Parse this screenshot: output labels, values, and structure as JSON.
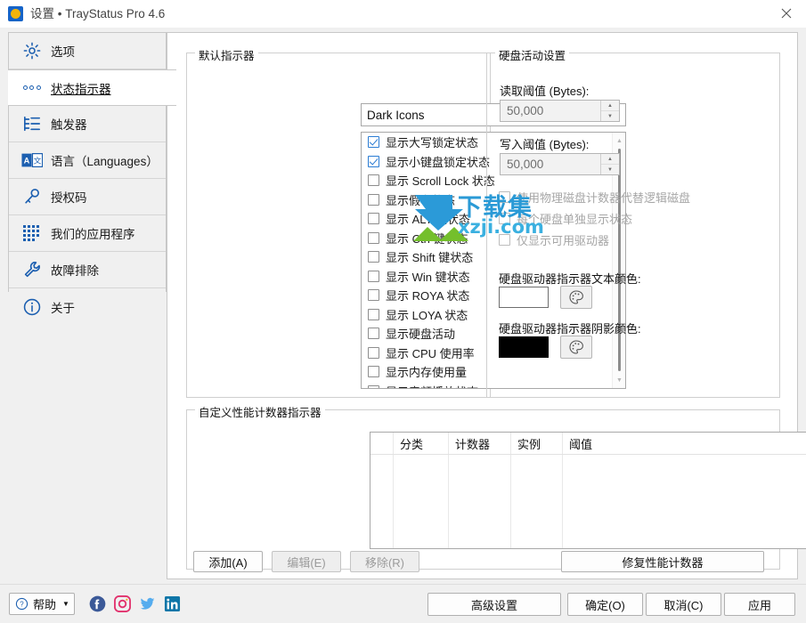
{
  "window": {
    "title": "设置 • TrayStatus Pro 4.6",
    "close_label": "✕",
    "icon": "app-icon"
  },
  "sidebar": {
    "items": [
      {
        "label": "选项",
        "icon": "gear-icon",
        "selected": false
      },
      {
        "label": "状态指示器",
        "icon": "dots-icon",
        "selected": true
      },
      {
        "label": "触发器",
        "icon": "trigger-tree-icon",
        "selected": false
      },
      {
        "label": "语言（Languages）",
        "icon": "language-icon",
        "selected": false
      },
      {
        "label": "授权码",
        "icon": "key-icon",
        "selected": false
      },
      {
        "label": "我们的应用程序",
        "icon": "apps-grid-icon",
        "selected": false
      },
      {
        "label": "故障排除",
        "icon": "wrench-icon",
        "selected": false
      },
      {
        "label": "关于",
        "icon": "info-icon",
        "selected": false
      }
    ]
  },
  "default_indicators": {
    "group_title": "默认指示器",
    "combo": {
      "value": "Dark Icons",
      "caret": "▼"
    },
    "items": [
      {
        "label": "显示大写锁定状态",
        "checked": true,
        "disabled": false
      },
      {
        "label": "显示小键盘锁定状态",
        "checked": true,
        "disabled": false
      },
      {
        "label": "显示 Scroll Lock 状态",
        "checked": false,
        "disabled": false
      },
      {
        "label": "显示假名状态",
        "checked": false,
        "disabled": false
      },
      {
        "label": "显示 ALT 键状态",
        "checked": false,
        "disabled": false
      },
      {
        "label": "显示 Ctrl 键状态",
        "checked": false,
        "disabled": false
      },
      {
        "label": "显示 Shift 键状态",
        "checked": false,
        "disabled": false
      },
      {
        "label": "显示 Win 键状态",
        "checked": false,
        "disabled": false
      },
      {
        "label": "显示 ROYA 状态",
        "checked": false,
        "disabled": false
      },
      {
        "label": "显示 LOYA 状态",
        "checked": false,
        "disabled": false
      },
      {
        "label": "显示硬盘活动",
        "checked": false,
        "disabled": false
      },
      {
        "label": "显示 CPU 使用率",
        "checked": false,
        "disabled": false
      },
      {
        "label": "显示内存使用量",
        "checked": false,
        "disabled": false
      },
      {
        "label": "显示音频播放状态",
        "checked": false,
        "disabled": false
      }
    ]
  },
  "disk_settings": {
    "group_title": "硬盘活动设置",
    "read_label": "读取阈值 (Bytes):",
    "read_value": "50,000",
    "write_label": "写入阈值 (Bytes):",
    "write_value": "50,000",
    "checkboxes": [
      {
        "label": "使用物理磁盘计数器代替逻辑磁盘",
        "checked": false,
        "disabled": true
      },
      {
        "label": "每个硬盘单独显示状态",
        "checked": false,
        "disabled": true
      },
      {
        "label": "仅显示可用驱动器",
        "checked": false,
        "disabled": true
      }
    ],
    "text_color_label": "硬盘驱动器指示器文本颜色:",
    "text_color_value": "#ffffff",
    "shadow_color_label": "硬盘驱动器指示器阴影颜色:",
    "shadow_color_value": "#000000",
    "palette_icon": "palette-icon",
    "spin_up": "▲",
    "spin_down": "▼"
  },
  "perf_counters": {
    "group_title": "自定义性能计数器指示器",
    "columns": [
      "分类",
      "计数器",
      "实例",
      "阈值"
    ],
    "rows": [],
    "buttons": {
      "add": {
        "label": "添加(A)",
        "disabled": false
      },
      "edit": {
        "label": "编辑(E)",
        "disabled": true
      },
      "remove": {
        "label": "移除(R)",
        "disabled": true
      },
      "repair": {
        "label": "修复性能计数器",
        "disabled": false
      }
    }
  },
  "footer": {
    "help_label": "帮助",
    "help_caret": "▼",
    "help_icon": "question-circle-icon",
    "social": [
      {
        "name": "facebook-icon",
        "color": "#3b5998"
      },
      {
        "name": "instagram-icon",
        "color": "#e1306c"
      },
      {
        "name": "twitter-icon",
        "color": "#55acee"
      },
      {
        "name": "linkedin-icon",
        "color": "#0e76a8"
      }
    ],
    "buttons": [
      {
        "label": "高级设置"
      },
      {
        "label": "确定(O)"
      },
      {
        "label": "取消(C)"
      },
      {
        "label": "应用"
      }
    ]
  },
  "watermark": {
    "line1": "下载集",
    "line2": "xzji.com",
    "logo_blue": "#2b9ad8",
    "logo_green": "#74bf2c"
  }
}
